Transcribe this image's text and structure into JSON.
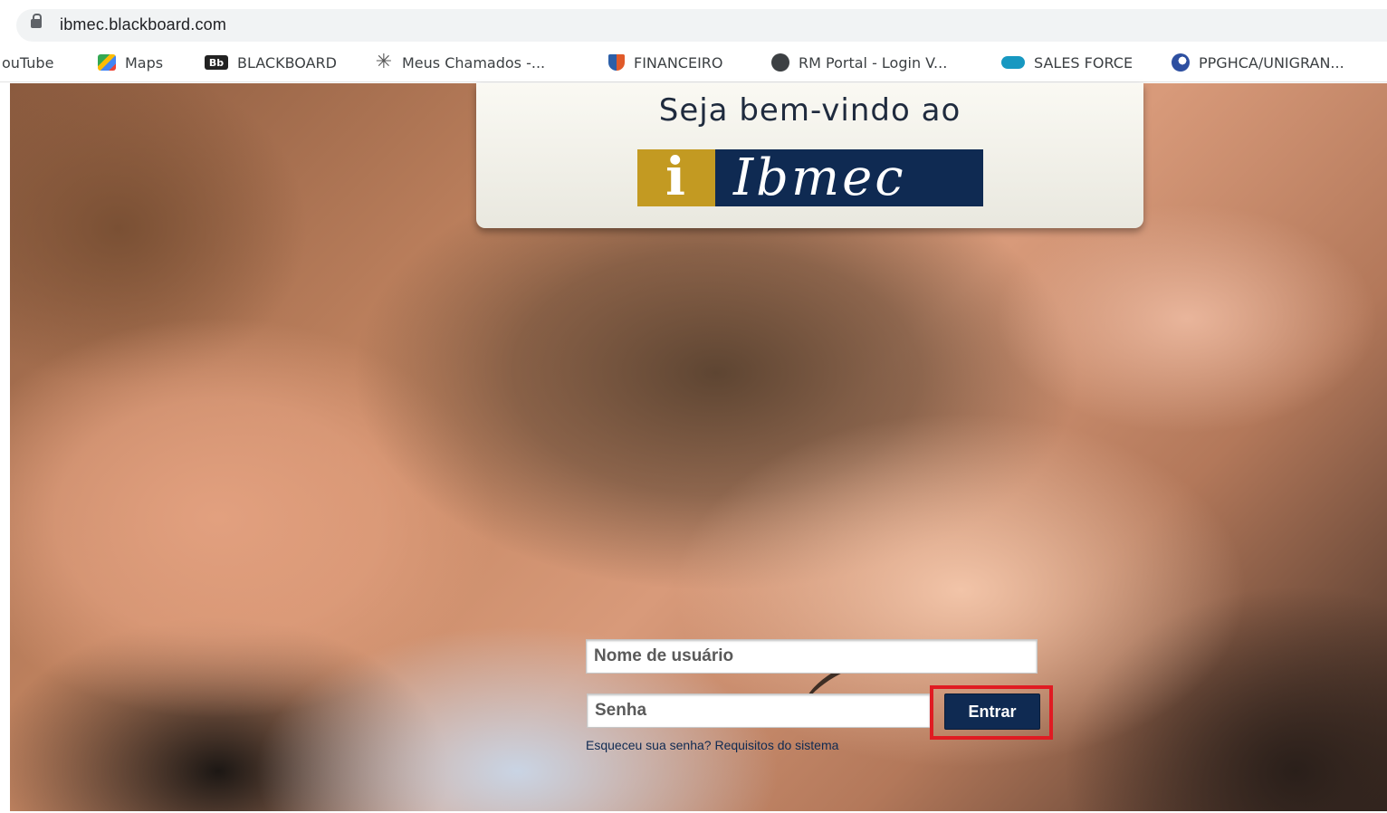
{
  "browser": {
    "url": "ibmec.blackboard.com",
    "bookmarks": [
      {
        "label": "ouTube",
        "icon": "youtube-icon"
      },
      {
        "label": "Maps",
        "icon": "maps-icon"
      },
      {
        "label": "BLACKBOARD",
        "icon": "blackboard-icon",
        "icon_text": "Bb"
      },
      {
        "label": "Meus Chamados -...",
        "icon": "asterisk-icon"
      },
      {
        "label": "FINANCEIRO",
        "icon": "shield-icon"
      },
      {
        "label": "RM Portal - Login V...",
        "icon": "globe-icon"
      },
      {
        "label": "SALES FORCE",
        "icon": "cloud-icon"
      },
      {
        "label": "PPGHCA/UNIGRAN...",
        "icon": "swirl-icon"
      }
    ]
  },
  "welcome": {
    "heading": "Seja bem-vindo ao",
    "logo_letter": "i",
    "logo_word": "Ibmec"
  },
  "login": {
    "username_placeholder": "Nome de usuário",
    "password_placeholder": "Senha",
    "submit_label": "Entrar",
    "forgot_link": "Esqueceu sua senha?",
    "requirements_link": "Requisitos do sistema"
  },
  "colors": {
    "brand_navy": "#0f2a52",
    "brand_gold": "#c39a22",
    "highlight_red": "#e01b22"
  }
}
